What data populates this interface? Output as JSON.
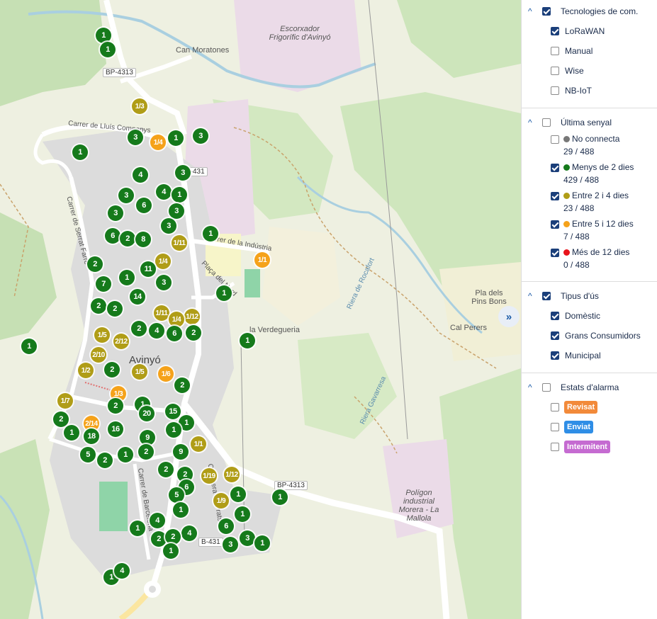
{
  "map": {
    "labels": {
      "town": "Avinyó",
      "can_moratones": "Can Moratones",
      "escorxador": "Escorxador Frigorífic d'Avinyó",
      "pla_pins": "Pla dels Pins Bons",
      "cal_perers": "Cal Perers",
      "verdegueria": "la Verdegueria",
      "poligon": "Polígon industrial Morera - La Mallola",
      "carrer_lluis": "Carrer de Lluís Companys",
      "carrer_serrat": "Carrer de Serrat Farré",
      "carrer_industria": "Carrer de la Indústria",
      "placa_nord": "Plaça del Nord",
      "carrer_barcelona": "Carrer de Barcelona",
      "carrer_prats": "Carretera de Prats",
      "riera": "Riera de Rocafort",
      "gavarresa": "Riera Gavarresa",
      "bp4313_a": "BP-4313",
      "bp4313_b": "BP-4313",
      "b431_a": "B-431",
      "b431_b": "B-431"
    },
    "markers": [
      {
        "t": "1",
        "c": "green"
      },
      {
        "t": "1",
        "c": "green"
      },
      {
        "t": "1/3",
        "c": "olive"
      },
      {
        "t": "3",
        "c": "green"
      },
      {
        "t": "1/4",
        "c": "orange"
      },
      {
        "t": "1",
        "c": "green"
      },
      {
        "t": "3",
        "c": "green"
      },
      {
        "t": "1",
        "c": "green"
      },
      {
        "t": "4",
        "c": "green"
      },
      {
        "t": "3",
        "c": "green"
      },
      {
        "t": "3",
        "c": "green"
      },
      {
        "t": "4",
        "c": "green"
      },
      {
        "t": "1",
        "c": "green"
      },
      {
        "t": "6",
        "c": "green"
      },
      {
        "t": "3",
        "c": "green"
      },
      {
        "t": "3",
        "c": "green"
      },
      {
        "t": "3",
        "c": "green"
      },
      {
        "t": "6",
        "c": "green"
      },
      {
        "t": "2",
        "c": "green"
      },
      {
        "t": "8",
        "c": "green"
      },
      {
        "t": "1/11",
        "c": "olive"
      },
      {
        "t": "1",
        "c": "green"
      },
      {
        "t": "1/1",
        "c": "orange"
      },
      {
        "t": "2",
        "c": "green"
      },
      {
        "t": "1/4",
        "c": "olive"
      },
      {
        "t": "11",
        "c": "green"
      },
      {
        "t": "1",
        "c": "green"
      },
      {
        "t": "7",
        "c": "green"
      },
      {
        "t": "3",
        "c": "green"
      },
      {
        "t": "14",
        "c": "green"
      },
      {
        "t": "1",
        "c": "green"
      },
      {
        "t": "2",
        "c": "green"
      },
      {
        "t": "2",
        "c": "green"
      },
      {
        "t": "1/11",
        "c": "olive"
      },
      {
        "t": "1/12",
        "c": "olive"
      },
      {
        "t": "1/4",
        "c": "olive"
      },
      {
        "t": "1/5",
        "c": "olive"
      },
      {
        "t": "2/12",
        "c": "olive"
      },
      {
        "t": "2",
        "c": "green"
      },
      {
        "t": "4",
        "c": "green"
      },
      {
        "t": "6",
        "c": "green"
      },
      {
        "t": "2",
        "c": "green"
      },
      {
        "t": "1",
        "c": "green"
      },
      {
        "t": "1",
        "c": "green"
      },
      {
        "t": "2/10",
        "c": "olive"
      },
      {
        "t": "2",
        "c": "green"
      },
      {
        "t": "1/5",
        "c": "olive"
      },
      {
        "t": "1/6",
        "c": "orange"
      },
      {
        "t": "1/2",
        "c": "olive"
      },
      {
        "t": "2",
        "c": "green"
      },
      {
        "t": "1/3",
        "c": "orange"
      },
      {
        "t": "1/7",
        "c": "olive"
      },
      {
        "t": "2",
        "c": "green"
      },
      {
        "t": "1",
        "c": "green"
      },
      {
        "t": "20",
        "c": "green"
      },
      {
        "t": "15",
        "c": "green"
      },
      {
        "t": "2",
        "c": "green"
      },
      {
        "t": "2/14",
        "c": "orange"
      },
      {
        "t": "1",
        "c": "green"
      },
      {
        "t": "18",
        "c": "green"
      },
      {
        "t": "1",
        "c": "green"
      },
      {
        "t": "16",
        "c": "green"
      },
      {
        "t": "1",
        "c": "green"
      },
      {
        "t": "9",
        "c": "green"
      },
      {
        "t": "5",
        "c": "green"
      },
      {
        "t": "2",
        "c": "green"
      },
      {
        "t": "1",
        "c": "green"
      },
      {
        "t": "2",
        "c": "green"
      },
      {
        "t": "9",
        "c": "green"
      },
      {
        "t": "1/1",
        "c": "olive"
      },
      {
        "t": "2",
        "c": "green"
      },
      {
        "t": "2",
        "c": "green"
      },
      {
        "t": "6",
        "c": "green"
      },
      {
        "t": "1/19",
        "c": "olive"
      },
      {
        "t": "1/12",
        "c": "olive"
      },
      {
        "t": "5",
        "c": "green"
      },
      {
        "t": "1",
        "c": "green"
      },
      {
        "t": "1/9",
        "c": "olive"
      },
      {
        "t": "1",
        "c": "green"
      },
      {
        "t": "4",
        "c": "green"
      },
      {
        "t": "1",
        "c": "green"
      },
      {
        "t": "1",
        "c": "green"
      },
      {
        "t": "1",
        "c": "green"
      },
      {
        "t": "4",
        "c": "green"
      },
      {
        "t": "6",
        "c": "green"
      },
      {
        "t": "2",
        "c": "green"
      },
      {
        "t": "2",
        "c": "green"
      },
      {
        "t": "3",
        "c": "green"
      },
      {
        "t": "3",
        "c": "green"
      },
      {
        "t": "1",
        "c": "green"
      },
      {
        "t": "1",
        "c": "green"
      },
      {
        "t": "1",
        "c": "green"
      },
      {
        "t": "4",
        "c": "green"
      }
    ]
  },
  "panel": {
    "tecnologies": {
      "title": "Tecnologies de com.",
      "checked": true,
      "items": [
        {
          "label": "LoRaWAN",
          "checked": true
        },
        {
          "label": "Manual",
          "checked": false
        },
        {
          "label": "Wise",
          "checked": false
        },
        {
          "label": "NB-IoT",
          "checked": false
        }
      ]
    },
    "senyal": {
      "title": "Última senyal",
      "checked": false,
      "items": [
        {
          "label": "No connecta",
          "count": "29 / 488",
          "color": "#777777",
          "checked": false
        },
        {
          "label": "Menys de 2 dies",
          "count": "429 / 488",
          "color": "#157a1b",
          "checked": true
        },
        {
          "label": "Entre 2 i 4 dies",
          "count": "23 / 488",
          "color": "#b09d17",
          "checked": true
        },
        {
          "label": "Entre 5 i 12 dies",
          "count": "7 / 488",
          "color": "#f5a21a",
          "checked": true
        },
        {
          "label": "Més de 12 dies",
          "count": "0 / 488",
          "color": "#e8141b",
          "checked": true
        }
      ]
    },
    "tipus": {
      "title": "Tipus d'ús",
      "checked": true,
      "items": [
        {
          "label": "Domèstic",
          "checked": true
        },
        {
          "label": "Grans Consumidors",
          "checked": true
        },
        {
          "label": "Municipal",
          "checked": true
        }
      ]
    },
    "alarma": {
      "title": "Estats d'alarma",
      "checked": false,
      "items": [
        {
          "label": "Revisat",
          "color": "#f28a3a",
          "checked": false
        },
        {
          "label": "Enviat",
          "color": "#2f8ee6",
          "checked": false
        },
        {
          "label": "Intermitent",
          "color": "#c56bd1",
          "checked": false
        }
      ]
    },
    "expand_icon": "double-chevron-right-icon"
  }
}
